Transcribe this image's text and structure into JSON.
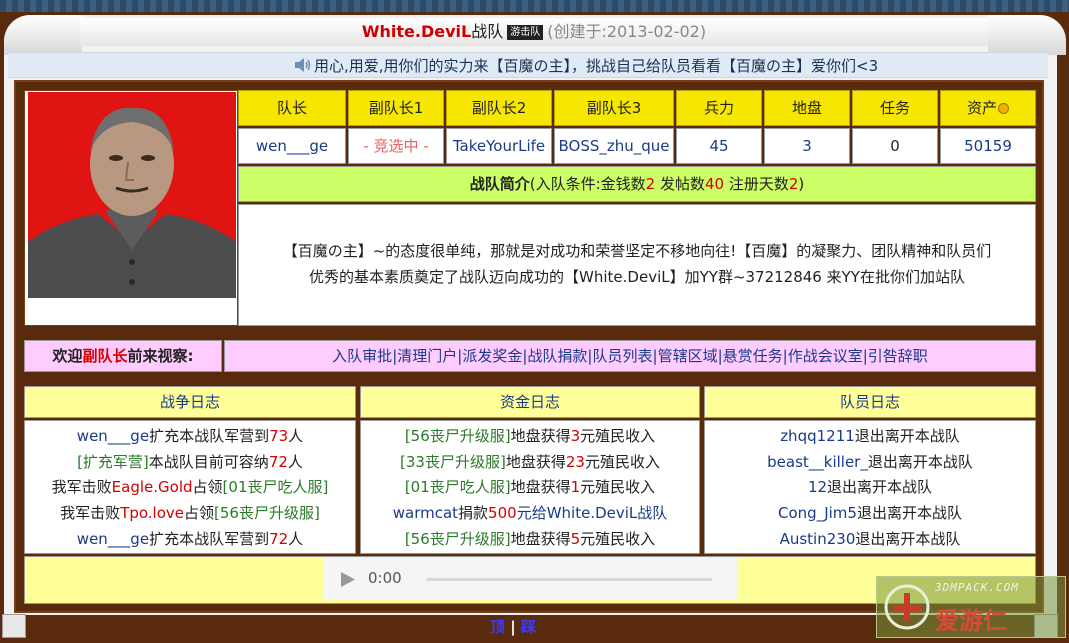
{
  "header": {
    "team_name": "White.DeviL",
    "team_suffix": "战队",
    "badge": "游击队",
    "created": "(创建于:2013-02-02)"
  },
  "announcement": "用心,用爱,用你们的实力来【百魔の主】，挑战自己给队员看看【百魔の主】爱你们<3",
  "stats": {
    "headers": [
      "队长",
      "副队长1",
      "副队长2",
      "副队长3",
      "兵力",
      "地盘",
      "任务",
      "资产"
    ],
    "values": [
      "wen___ge",
      "- 竞选中 -",
      "TakeYourLife",
      "BOSS_zhu_que",
      "45",
      "3",
      "0",
      "50159"
    ]
  },
  "intro": {
    "label": "战队简介",
    "cond_open": "(入队条件:金钱数",
    "money": "2",
    "posts_label": " 发帖数",
    "posts": "40",
    "days_label": " 注册天数",
    "days": "2",
    "cond_close": ")",
    "text_line1": "【百魔の主】~的态度很单纯，那就是对成功和荣誉坚定不移地向往!【百魔】的凝聚力、团队精神和队员们",
    "text_line2": "优秀的基本素质奠定了战队迈向成功的【White.DeviL】加YY群~37212846 来YY在批你们加站队"
  },
  "welcome": {
    "prefix": "欢迎",
    "role": "副队长",
    "suffix": "前来视察:"
  },
  "admin_links": [
    "入队审批",
    "清理门户",
    "派发奖金",
    "战队捐款",
    "队员列表",
    "管辖区域",
    "悬赏任务",
    "作战会议室",
    "引咎辞职"
  ],
  "logs": {
    "war_title": "战争日志",
    "fund_title": "资金日志",
    "member_title": "队员日志",
    "war": [
      {
        "a": "wen___ge",
        "b": "扩充本战队军营到",
        "n": "73",
        "c": "人"
      },
      {
        "a": "[扩充军营]",
        "b": "本战队目前可容纳",
        "n": "72",
        "c": "人"
      },
      {
        "a": "我军击败",
        "b": "Eagle.Gold",
        "n": "占领",
        "c": "[01丧尸吃人服]"
      },
      {
        "a": "我军击败",
        "b": "Tpo.love",
        "n": "占领",
        "c": "[56丧尸升级服]"
      },
      {
        "a": "wen___ge",
        "b": "扩充本战队军营到",
        "n": "72",
        "c": "人"
      }
    ],
    "fund": [
      {
        "a": "[56丧尸升级服]",
        "b": "地盘获得",
        "n": "3",
        "c": "元殖民收入"
      },
      {
        "a": "[33丧尸升级服]",
        "b": "地盘获得",
        "n": "23",
        "c": "元殖民收入"
      },
      {
        "a": "[01丧尸吃人服]",
        "b": "地盘获得",
        "n": "1",
        "c": "元殖民收入"
      },
      {
        "a": "warmcat",
        "b": "捐款",
        "n": "500",
        "c": "元给White.DeviL战队"
      },
      {
        "a": "[56丧尸升级服]",
        "b": "地盘获得",
        "n": "5",
        "c": "元殖民收入"
      }
    ],
    "member": [
      {
        "a": "zhqq1211",
        "b": "退出离开本战队"
      },
      {
        "a": "beast__killer_",
        "b": "退出离开本战队"
      },
      {
        "a": "12",
        "b": "退出离开本战队"
      },
      {
        "a": "Cong_Jim5",
        "b": "退出离开本战队"
      },
      {
        "a": "Austin230",
        "b": "退出离开本战队"
      }
    ]
  },
  "player": {
    "time": "0:00",
    "progress": 0
  },
  "bottom_links": {
    "top": "顶",
    "bottom": "踩",
    "sep": "|"
  },
  "watermark": {
    "line1": "3DMPACK.COM",
    "line2": "爱游仁"
  },
  "colors": {
    "frame_brown": "#5a2a0c",
    "header_yellow": "#f6e600",
    "intro_green": "#ccff66",
    "admin_pink": "#ffccff",
    "log_yellow": "#ffff99",
    "link_blue": "#1a3a8a",
    "accent_red": "#d40000"
  }
}
